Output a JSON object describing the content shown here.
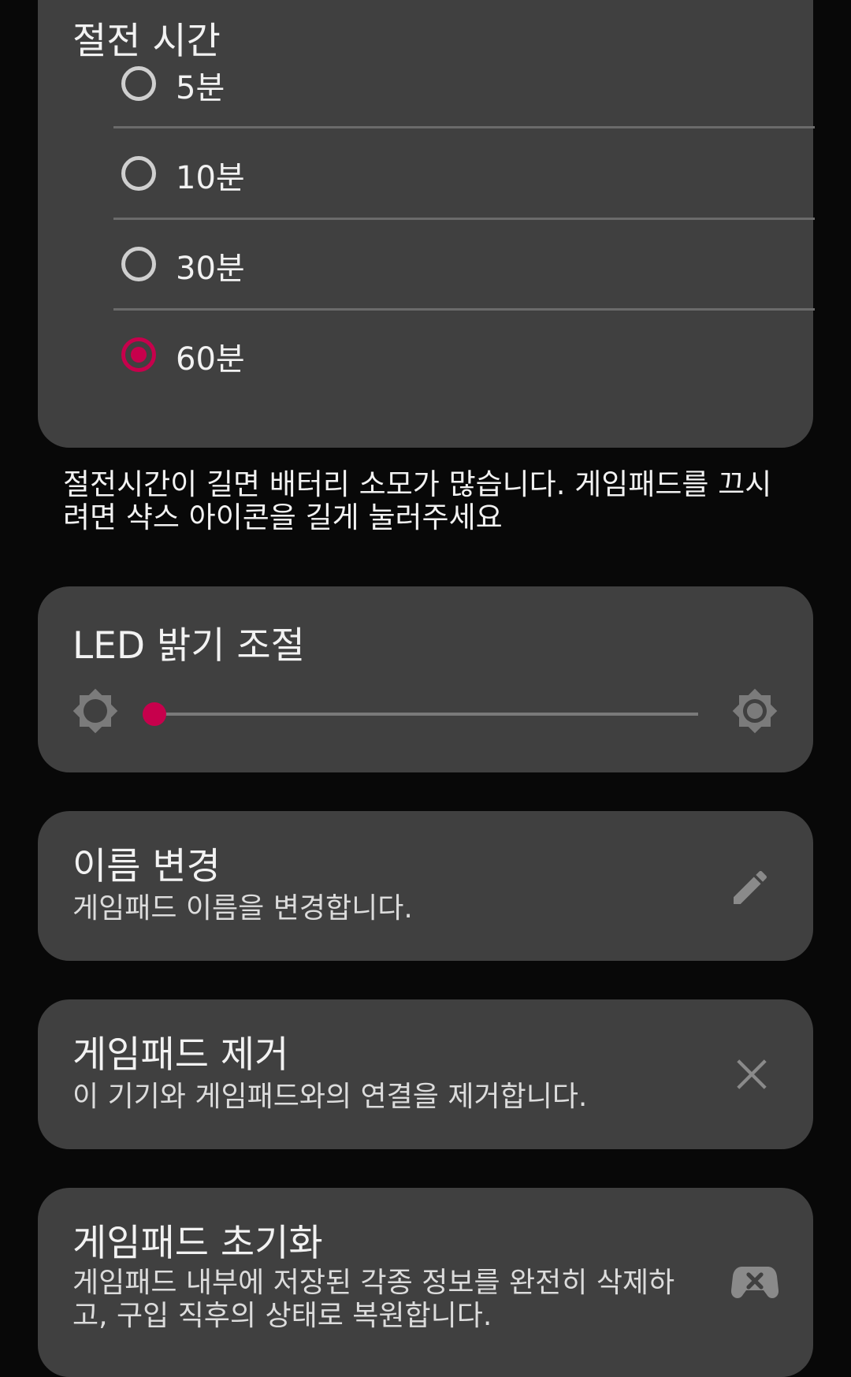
{
  "sleep": {
    "title": "절전 시간",
    "options": [
      "5분",
      "10분",
      "30분",
      "60분"
    ],
    "selected": "60분",
    "note": "절전시간이 길면 배터리 소모가 많습니다. 게임패드를 끄시려면 샥스 아이콘을 길게 눌러주세요"
  },
  "led": {
    "title": "LED 밝기 조절",
    "brightness_level": 0
  },
  "rename": {
    "title": "이름 변경",
    "subtitle": "게임패드 이름을 변경합니다."
  },
  "remove": {
    "title": "게임패드 제거",
    "subtitle": "이 기기와 게임패드와의 연결을 제거합니다."
  },
  "reset": {
    "title": "게임패드 초기화",
    "subtitle": "게임패드 내부에 저장된 각종 정보를 완전히 삭제하고, 구입 직후의 상태로 복원합니다."
  },
  "colors": {
    "accent": "#c7004c",
    "card": "#404040",
    "background": "#080808"
  },
  "icons": [
    "brightness-low-icon",
    "brightness-high-icon",
    "pencil-icon",
    "close-icon",
    "gamepad-icon"
  ]
}
